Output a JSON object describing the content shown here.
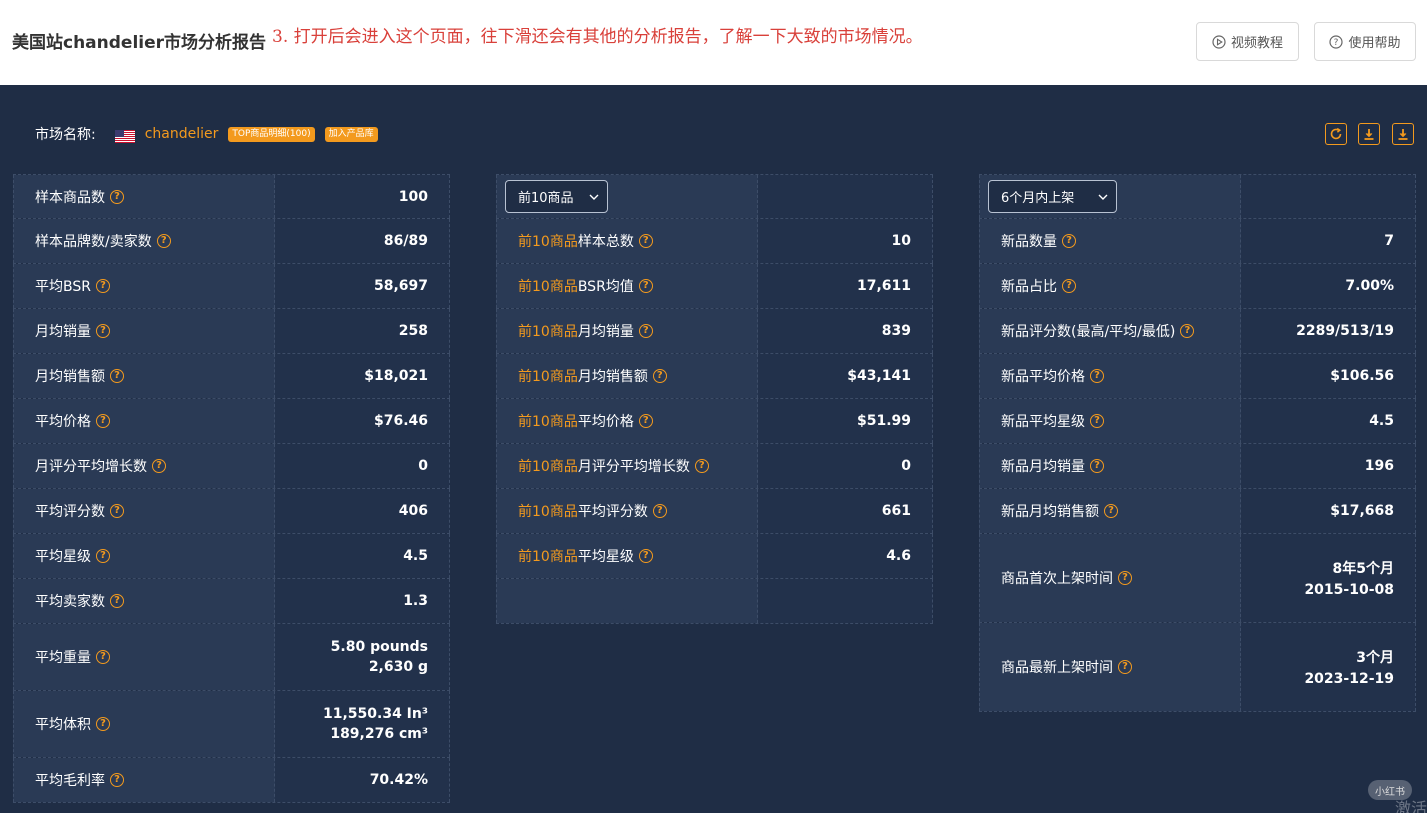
{
  "header": {
    "title": "美国站chandelier市场分析报告",
    "annotation": "3. 打开后会进入这个页面，往下滑还会有其他的分析报告，了解一下大致的市场情况。",
    "video_btn": "视频教程",
    "help_btn": "使用帮助"
  },
  "market": {
    "label": "市场名称:",
    "name": "chandelier",
    "tag_top": "TOP商品明细(100)",
    "tag_add": "加入产品库"
  },
  "colors": {
    "accent": "#f39a1e",
    "bg": "#1f2d45",
    "annotation": "#d9403a"
  },
  "panel1": {
    "rows": [
      {
        "label": "样本商品数",
        "value": "100"
      },
      {
        "label": "样本品牌数/卖家数",
        "value": "86/89"
      },
      {
        "label": "平均BSR",
        "value": "58,697"
      },
      {
        "label": "月均销量",
        "value": "258"
      },
      {
        "label": "月均销售额",
        "value": "$18,021"
      },
      {
        "label": "平均价格",
        "value": "$76.46"
      },
      {
        "label": "月评分平均增长数",
        "value": "0"
      },
      {
        "label": "平均评分数",
        "value": "406"
      },
      {
        "label": "平均星级",
        "value": "4.5"
      },
      {
        "label": "平均卖家数",
        "value": "1.3"
      },
      {
        "label": "平均重量",
        "value": "5.80 pounds",
        "value2": "2,630 g"
      },
      {
        "label": "平均体积",
        "value": "11,550.34 In³",
        "value2": "189,276 cm³"
      },
      {
        "label": "平均毛利率",
        "value": "70.42%"
      }
    ]
  },
  "panel2": {
    "select": "前10商品",
    "prefix": "前10商品",
    "rows": [
      {
        "label": "样本总数",
        "value": "10"
      },
      {
        "label": "BSR均值",
        "value": "17,611"
      },
      {
        "label": "月均销量",
        "value": "839"
      },
      {
        "label": "月均销售额",
        "value": "$43,141"
      },
      {
        "label": "平均价格",
        "value": "$51.99"
      },
      {
        "label": "月评分平均增长数",
        "value": "0"
      },
      {
        "label": "平均评分数",
        "value": "661"
      },
      {
        "label": "平均星级",
        "value": "4.6"
      }
    ]
  },
  "panel3": {
    "select": "6个月内上架",
    "rows": [
      {
        "label": "新品数量",
        "value": "7"
      },
      {
        "label": "新品占比",
        "value": "7.00%"
      },
      {
        "label": "新品评分数(最高/平均/最低)",
        "value": "2289/513/19"
      },
      {
        "label": "新品平均价格",
        "value": "$106.56"
      },
      {
        "label": "新品平均星级",
        "value": "4.5"
      },
      {
        "label": "新品月均销量",
        "value": "196"
      },
      {
        "label": "新品月均销售额",
        "value": "$17,668"
      },
      {
        "label": "商品首次上架时间",
        "value": "8年5个月",
        "value2": "2015-10-08"
      },
      {
        "label": "商品最新上架时间",
        "value": "3个月",
        "value2": "2023-12-19"
      }
    ]
  },
  "watermark": {
    "text": "小红书",
    "text2": "激活"
  }
}
